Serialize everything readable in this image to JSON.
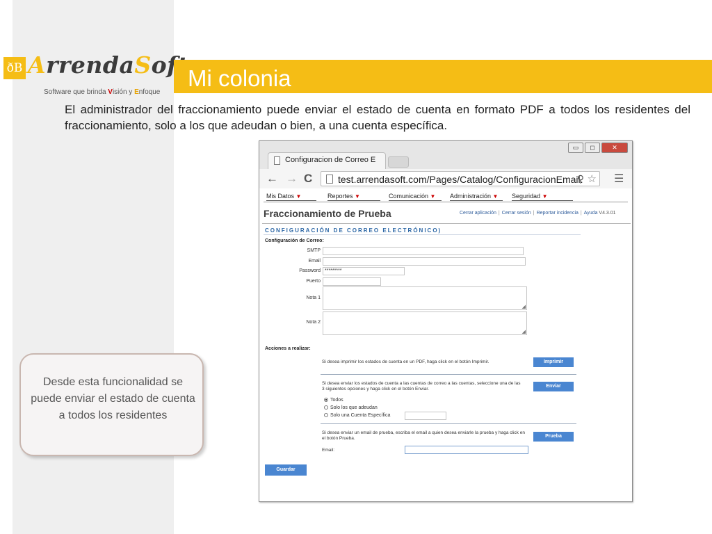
{
  "slide": {
    "title": "Mi colonia",
    "intro": "El administrador del fraccionamiento puede enviar el estado de cuenta en formato PDF a todos los residentes del fraccionamiento, solo a los que adeudan o bien, a una cuenta específica.",
    "callout": "Desde esta funcionalidad se puede enviar el estado de cuenta a todos los residentes",
    "logo": {
      "badge": "ðB",
      "name_a": "A",
      "name_mid": "rrenda",
      "name_s": "S",
      "name_end": "oft",
      "tag_pre": "Software que brinda ",
      "tag_v": "V",
      "tag_mid": "isión y ",
      "tag_e": "E",
      "tag_end": "nfoque"
    },
    "colors": {
      "accent": "#f5bd15",
      "button": "#4a86d1",
      "link": "#2d5b9a"
    }
  },
  "browser": {
    "tab_label": "Configuracion de Correo E",
    "url": "test.arrendasoft.com/Pages/Catalog/ConfiguracionEmail.",
    "nav": {
      "back": "←",
      "forward": "→",
      "reload": "C"
    },
    "window_buttons": {
      "minimize": "▭",
      "maximize": "◻",
      "close": "✕"
    }
  },
  "app": {
    "menu": [
      "Mis Datos",
      "Reportes",
      "Comunicación",
      "Administración",
      "Seguridad"
    ],
    "page_title": "Fraccionamiento de Prueba",
    "links": [
      "Cerrar aplicación",
      "Cerrar sesión",
      "Reportar incidencia",
      "Ayuda"
    ],
    "version": "V4.3.01",
    "section_title": "CONFIGURACIÓN DE CORREO ELECTRÓNICO)",
    "subsection": "Configuración de Correo:",
    "fields": {
      "smtp": {
        "label": "SMTP",
        "value": ""
      },
      "email": {
        "label": "Email",
        "value": ""
      },
      "password": {
        "label": "Password",
        "value": "*********"
      },
      "puerto": {
        "label": "Puerto",
        "value": ""
      },
      "nota1": {
        "label": "Nota 1",
        "value": ""
      },
      "nota2": {
        "label": "Nota 2",
        "value": ""
      }
    },
    "actions": {
      "title": "Acciones a realizar:",
      "print_text": "Si desea imprimir los estados de cuenta en un PDF, haga click en el botón Imprimir.",
      "print_button": "Imprimir",
      "send_text": "Si desea enviar los estados de cuenta a las cuentas de correo a las cuentas, seleccione una de las 3 siguientes opciones y haga click en el botón Enviar.",
      "send_button": "Enviar",
      "options": [
        "Todos",
        "Solo los que adeudan",
        "Solo una Cuenta Específica"
      ],
      "selected_option": "Todos",
      "test_text": "Si desea enviar un email de prueba, escriba el email a quien desea enviarle la prueba y haga click en el botón Prueba.",
      "test_button": "Prueba",
      "test_email_label": "Email:",
      "test_email_value": ""
    },
    "save_button": "Guardar"
  }
}
